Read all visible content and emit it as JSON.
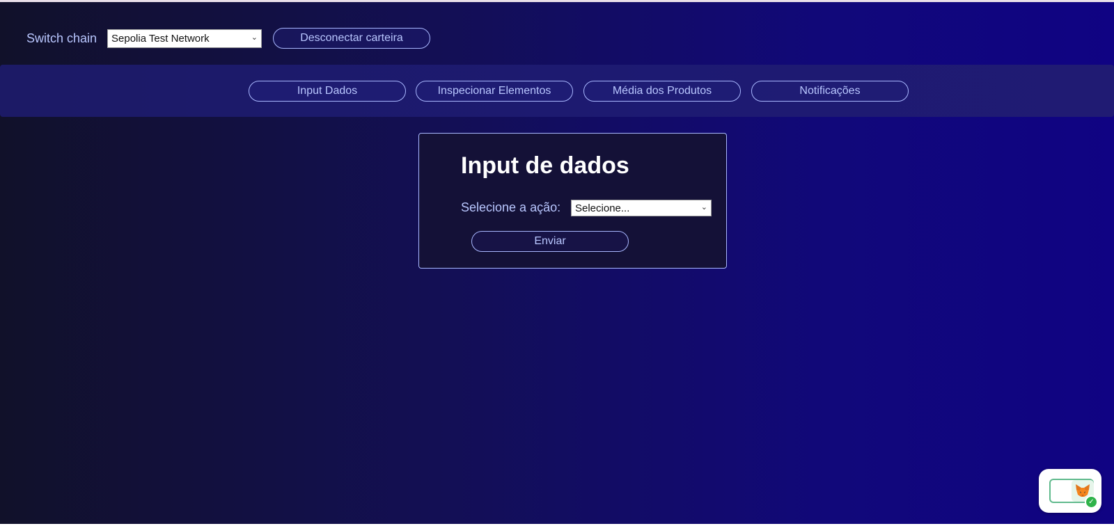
{
  "header": {
    "switch_chain_label": "Switch chain",
    "chain_select_value": "Sepolia Test Network",
    "disconnect_label": "Desconectar carteira"
  },
  "nav": {
    "items": [
      {
        "label": "Input Dados"
      },
      {
        "label": "Inspecionar Elementos"
      },
      {
        "label": "Média dos Produtos"
      },
      {
        "label": "Notificações"
      }
    ]
  },
  "card": {
    "title": "Input de dados",
    "action_label": "Selecione a ação:",
    "action_select_value": "Selecione...",
    "submit_label": "Enviar"
  },
  "icons": {
    "select_chevron": "chevron-down-icon",
    "wallet_widget": "metamask-fox-icon",
    "connected": "check-icon"
  },
  "colors": {
    "accent_text": "#b9c7ff",
    "button_border": "#a9b8ff",
    "nav_band": "#1d1a72",
    "card_bg": "#141137",
    "connected_green": "#2fb34a"
  }
}
